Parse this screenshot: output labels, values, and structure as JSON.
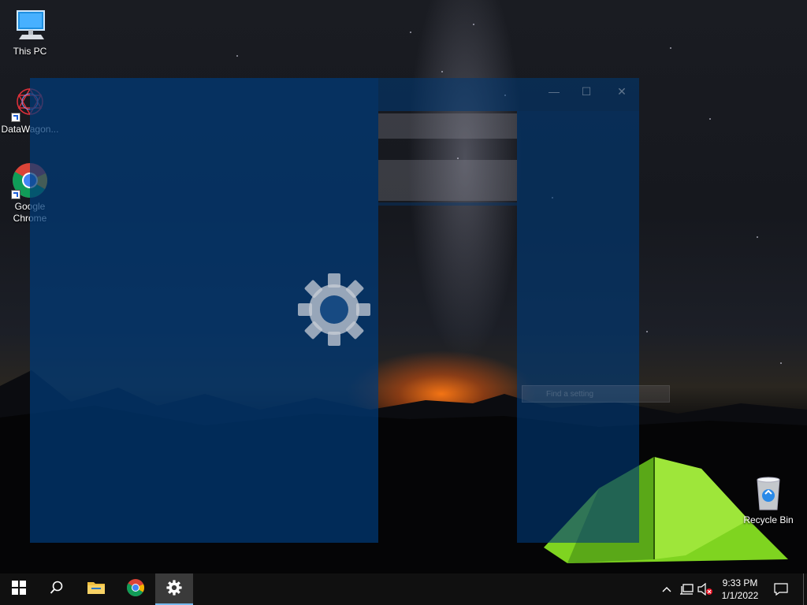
{
  "desktop": {
    "icons": [
      {
        "label": "This PC",
        "icon": "computer-icon"
      },
      {
        "label": "DataWagon...",
        "icon": "datawagon-icon"
      },
      {
        "label": "Google Chrome",
        "icon": "chrome-icon"
      },
      {
        "label": "Recycle Bin",
        "icon": "recycle-bin-icon"
      }
    ]
  },
  "settings_window": {
    "app": "Settings",
    "search_placeholder": "Find a setting",
    "controls": {
      "minimize": "—",
      "maximize": "☐",
      "close": "✕"
    },
    "accent_color": "#003a78"
  },
  "taskbar": {
    "apps": [
      {
        "name": "Start",
        "icon": "windows-logo-icon"
      },
      {
        "name": "Search",
        "icon": "search-icon"
      },
      {
        "name": "File Explorer",
        "icon": "folder-icon"
      },
      {
        "name": "Google Chrome",
        "icon": "chrome-icon"
      },
      {
        "name": "Settings",
        "icon": "gear-icon",
        "active": true
      }
    ],
    "tray": {
      "chevron": "^",
      "time": "9:33 PM",
      "date": "1/1/2022"
    }
  }
}
